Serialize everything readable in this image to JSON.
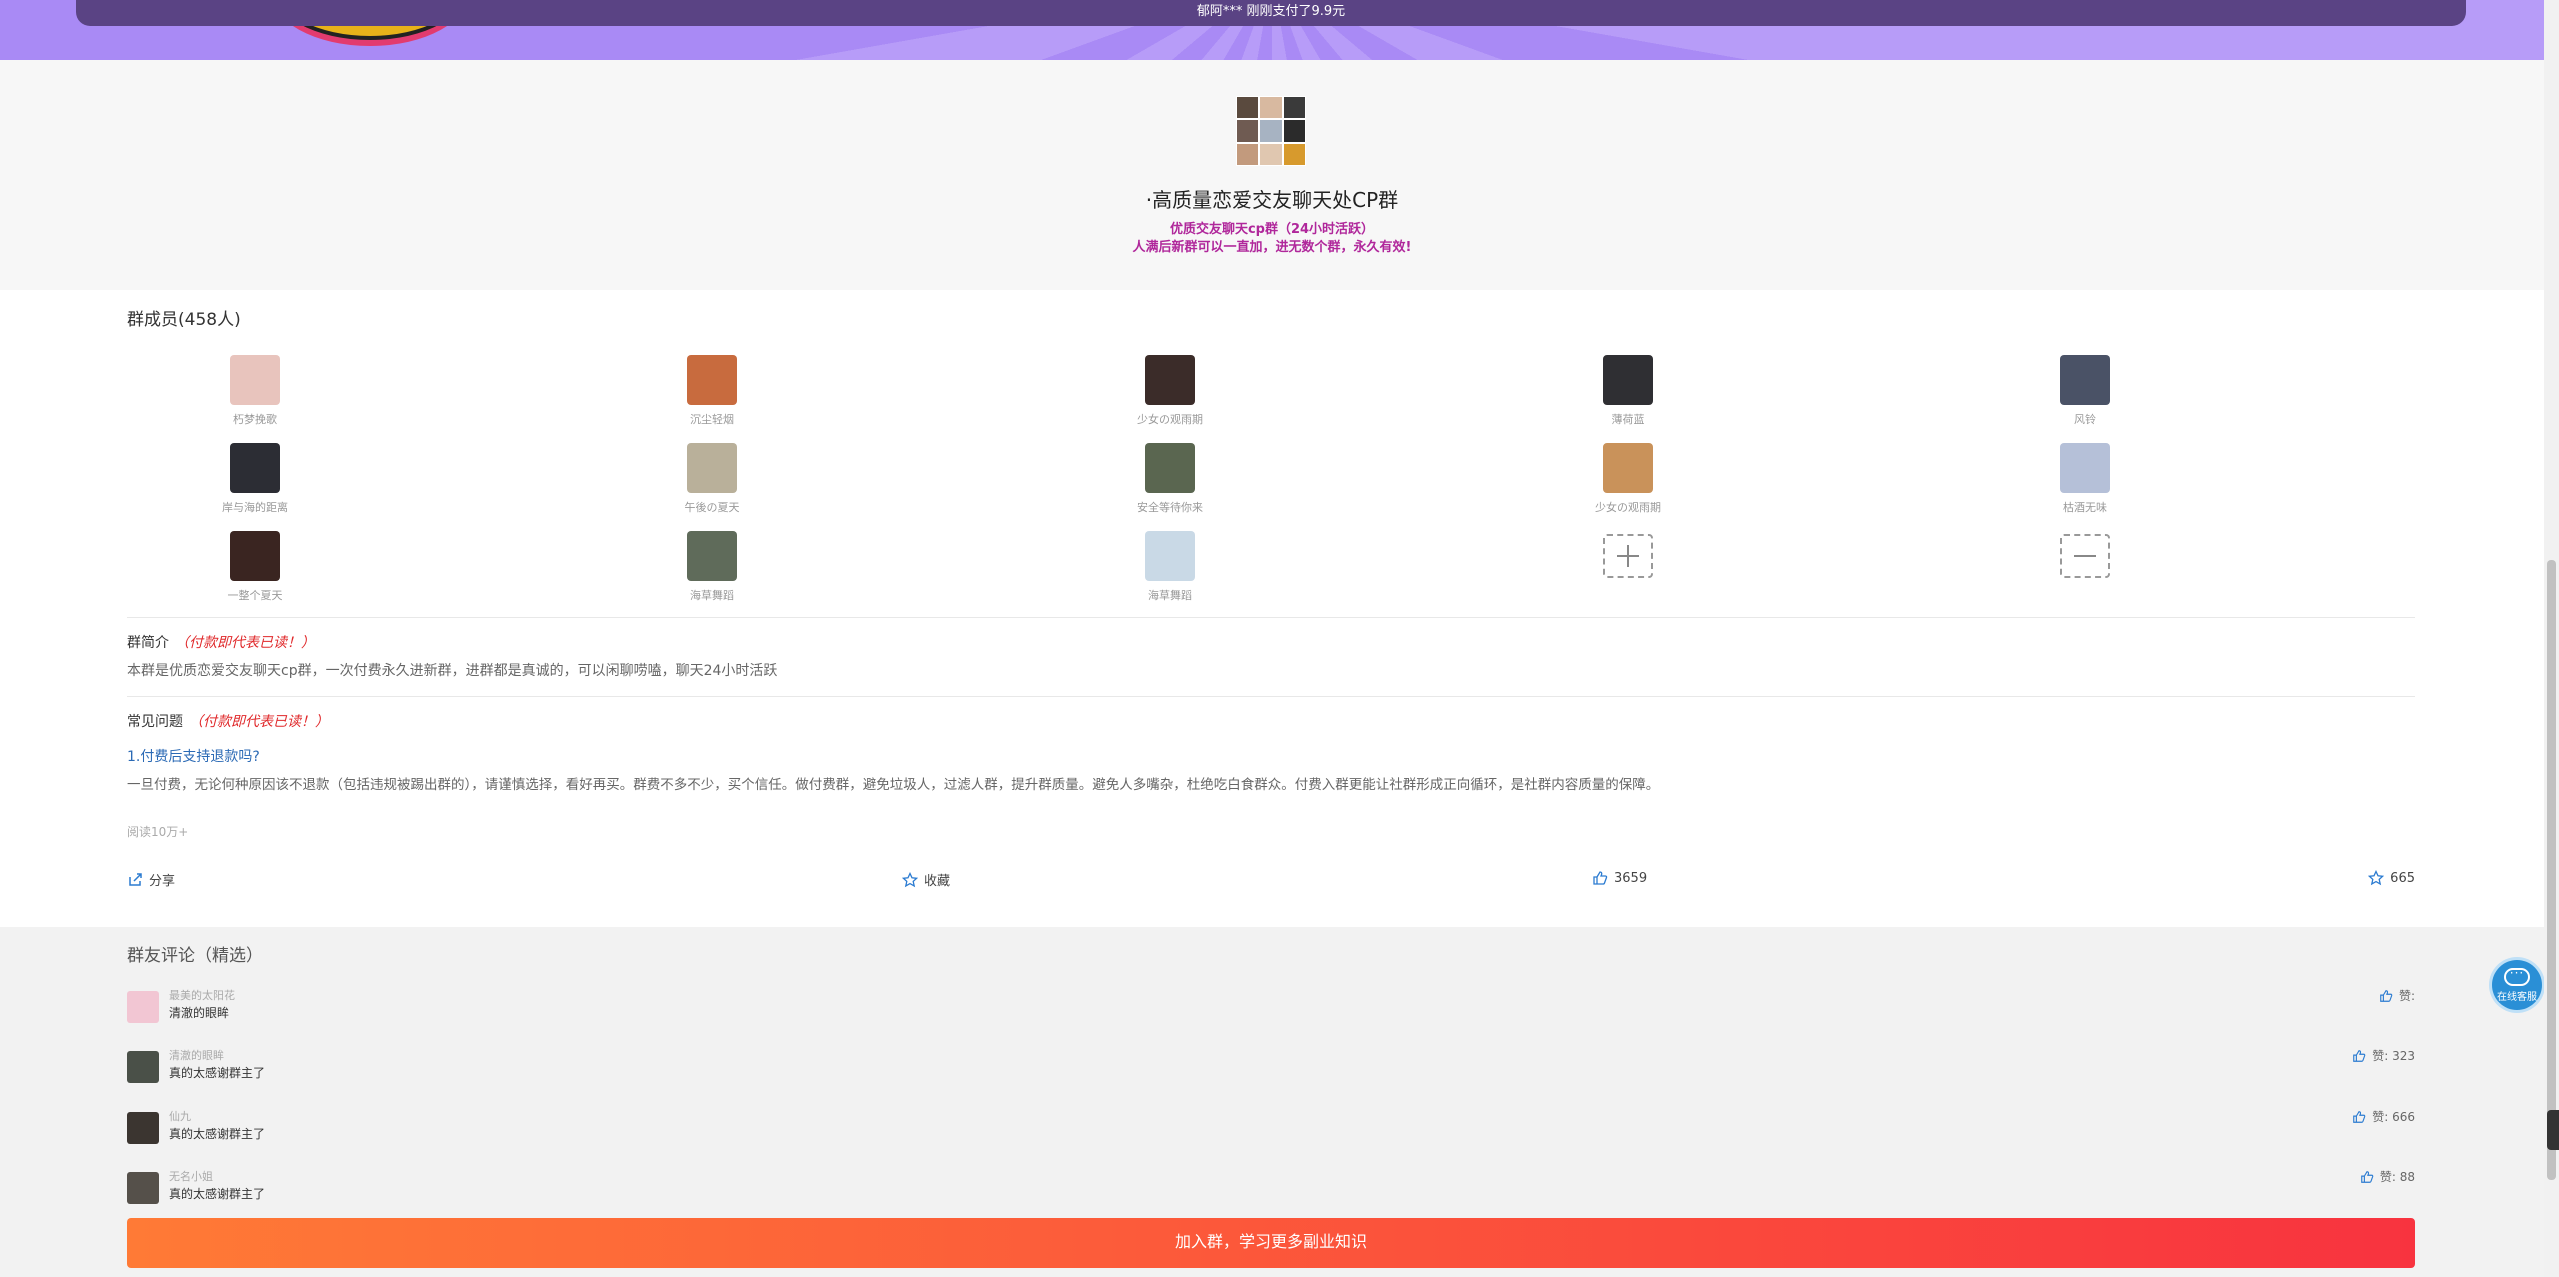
{
  "banner": {
    "marquee_text": "郁阿*** 刚刚支付了9.9元"
  },
  "group": {
    "title": "·高质量恋爱交友聊天处CP群",
    "sub1": "优质交友聊天cp群（24小时活跃）",
    "sub2": "人满后新群可以一直加，进无数个群，永久有效!",
    "avatar_colors": [
      "#5a4a3e",
      "#d8b9a0",
      "#3a3a3a",
      "#6f5b52",
      "#a7b3c2",
      "#2b2b2b",
      "#c29a7d",
      "#e0c7b0",
      "#d79a2d"
    ]
  },
  "members": {
    "title": "群成员(458人)",
    "items": [
      {
        "name": "朽梦挽歌",
        "color": "#e8c4bd"
      },
      {
        "name": "沉尘轻烟",
        "color": "#c86b3e"
      },
      {
        "name": "少女の观雨期",
        "color": "#3b2c29"
      },
      {
        "name": "薄荷蓝",
        "color": "#2f2f33"
      },
      {
        "name": "风铃",
        "color": "#4a5266"
      },
      {
        "name": "岸与海的距离",
        "color": "#2c2d34"
      },
      {
        "name": "午後の夏天",
        "color": "#b9b09a"
      },
      {
        "name": "安全等待你来",
        "color": "#5a6650"
      },
      {
        "name": "少女の观雨期",
        "color": "#c9925a"
      },
      {
        "name": "枯酒无味",
        "color": "#b5c0d8"
      },
      {
        "name": "一整个夏天",
        "color": "#3a2521"
      },
      {
        "name": "海草舞蹈",
        "color": "#5f6b5a"
      },
      {
        "name": "海草舞蹈",
        "color": "#c9d9e6"
      }
    ]
  },
  "intro": {
    "label": "群简介",
    "note": "（付款即代表已读！）",
    "text": "本群是优质恋爱交友聊天cp群，一次付费永久进新群，进群都是真诚的，可以闲聊唠嗑，聊天24小时活跃"
  },
  "faq": {
    "label": "常见问题",
    "note": "（付款即代表已读！）",
    "question": "1.付费后支持退款吗?",
    "answer": "一旦付费，无论何种原因该不退款（包括违规被踢出群的），请谨慎选择，看好再买。群费不多不少，买个信任。做付费群，避免垃圾人，过滤人群，提升群质量。避免人多嘴杂，杜绝吃白食群众。付费入群更能让社群形成正向循环，是社群内容质量的保障。",
    "reads": "阅读10万+"
  },
  "actions": {
    "share": "分享",
    "favorite": "收藏",
    "likes": "3659",
    "stars": "665"
  },
  "comments": {
    "title": "群友评论（精选）",
    "items": [
      {
        "name": "最美的太阳花",
        "text": "清澈的眼眸",
        "likes": "赞:",
        "color": "#f2c6d3"
      },
      {
        "name": "清澈的眼眸",
        "text": "真的太感谢群主了",
        "likes": "赞: 323",
        "color": "#4a5048"
      },
      {
        "name": "仙九",
        "text": "真的太感谢群主了",
        "likes": "赞: 666",
        "color": "#3b3530"
      },
      {
        "name": "无名小姐",
        "text": "真的太感谢群主了",
        "likes": "赞: 88",
        "color": "#55504a"
      }
    ]
  },
  "join_button": "加入群，学习更多副业知识",
  "service": {
    "label": "在线客服"
  }
}
